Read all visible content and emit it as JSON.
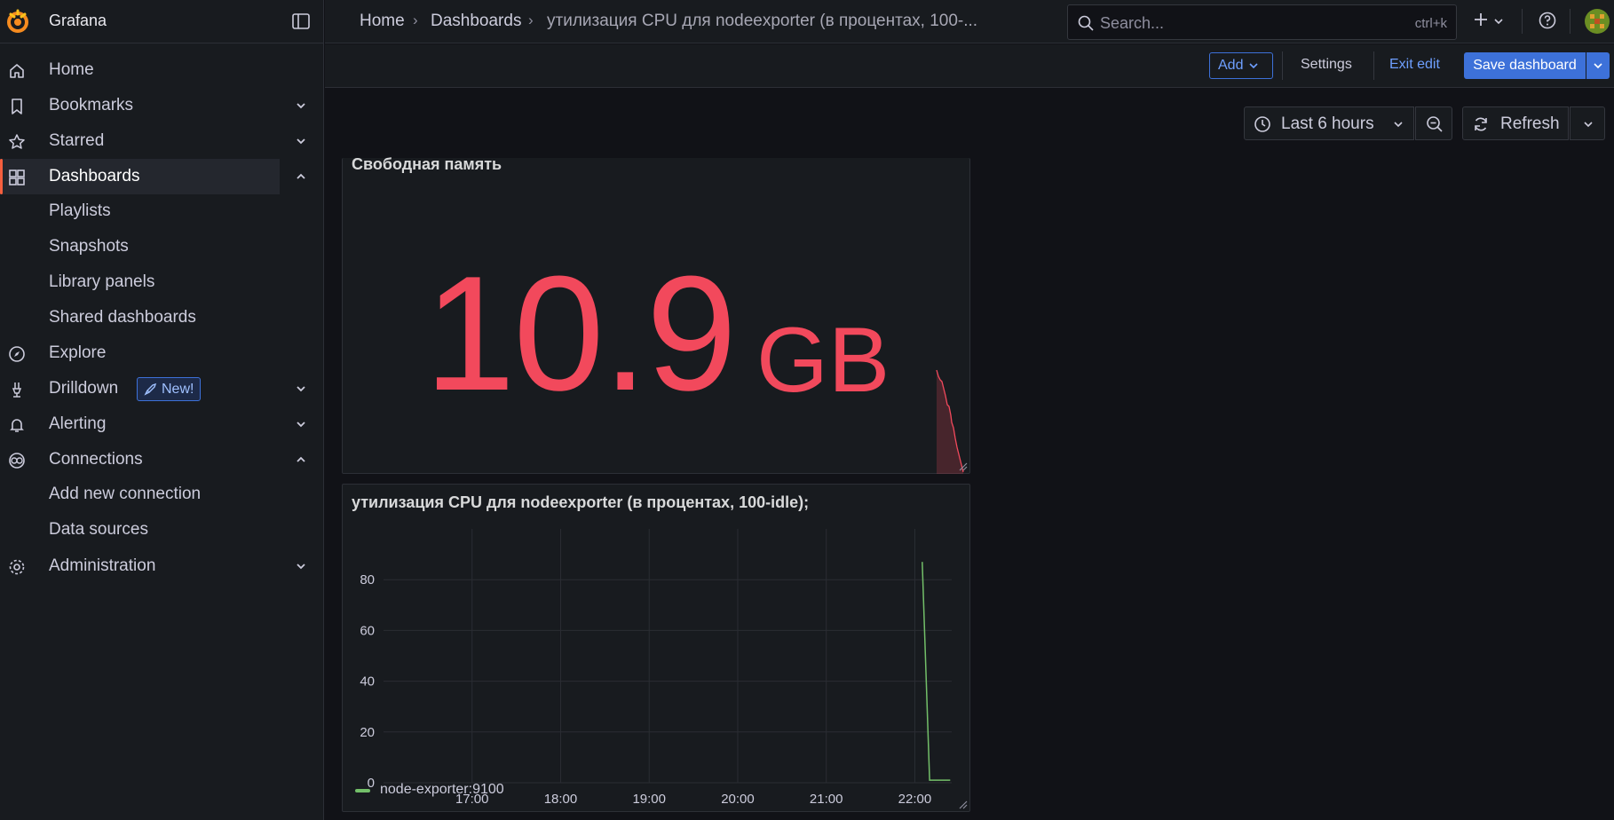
{
  "app": {
    "title": "Grafana"
  },
  "sidebar": {
    "items": [
      {
        "label": "Home",
        "icon": "home-icon"
      },
      {
        "label": "Bookmarks",
        "icon": "bookmark-icon"
      },
      {
        "label": "Starred",
        "icon": "star-icon"
      },
      {
        "label": "Dashboards",
        "icon": "dashboards-icon",
        "active": true
      },
      {
        "label": "Explore",
        "icon": "compass-icon"
      },
      {
        "label": "Drilldown",
        "icon": "drilldown-icon",
        "badge": "New!"
      },
      {
        "label": "Alerting",
        "icon": "bell-icon"
      },
      {
        "label": "Connections",
        "icon": "connections-icon"
      },
      {
        "label": "Administration",
        "icon": "gear-icon"
      }
    ],
    "dashboards_children": [
      "Playlists",
      "Snapshots",
      "Library panels",
      "Shared dashboards"
    ],
    "connections_children": [
      "Add new connection",
      "Data sources"
    ]
  },
  "breadcrumb": {
    "home": "Home",
    "dashboards": "Dashboards",
    "current": "утилизация CPU для nodeexporter (в процентах, 100-..."
  },
  "search": {
    "placeholder": "Search...",
    "shortcut": "ctrl+k"
  },
  "toolbar": {
    "add_label": "Add",
    "settings_label": "Settings",
    "exit_edit_label": "Exit edit",
    "save_label": "Save dashboard"
  },
  "time_controls": {
    "range_label": "Last 6 hours",
    "refresh_label": "Refresh"
  },
  "panels": {
    "memory": {
      "title": "Свободная память",
      "value": "10.9",
      "unit": "GB",
      "color": "#f2495c"
    },
    "cpu": {
      "title": "утилизация CPU для nodeexporter (в процентах, 100-idle);"
    }
  },
  "colors": {
    "accent": "#3d71d9",
    "active_indicator": "#f55f3e",
    "stat_red": "#f2495c",
    "series_green": "#73bf69"
  },
  "chart_data": {
    "type": "line",
    "title": "утилизация CPU для nodeexporter (в процентах, 100-idle);",
    "x_ticks": [
      "17:00",
      "18:00",
      "19:00",
      "20:00",
      "21:00",
      "22:00"
    ],
    "y_ticks": [
      0,
      20,
      40,
      60,
      80
    ],
    "ylim": [
      0,
      100
    ],
    "xlim": [
      "16:00",
      "22:25"
    ],
    "grid": true,
    "legend": "bottom-left",
    "series": [
      {
        "name": "node-exporter:9100",
        "color": "#73bf69",
        "points": [
          {
            "x": "22:05",
            "y": 87
          },
          {
            "x": "22:10",
            "y": 1
          },
          {
            "x": "22:24",
            "y": 1
          }
        ]
      }
    ]
  }
}
